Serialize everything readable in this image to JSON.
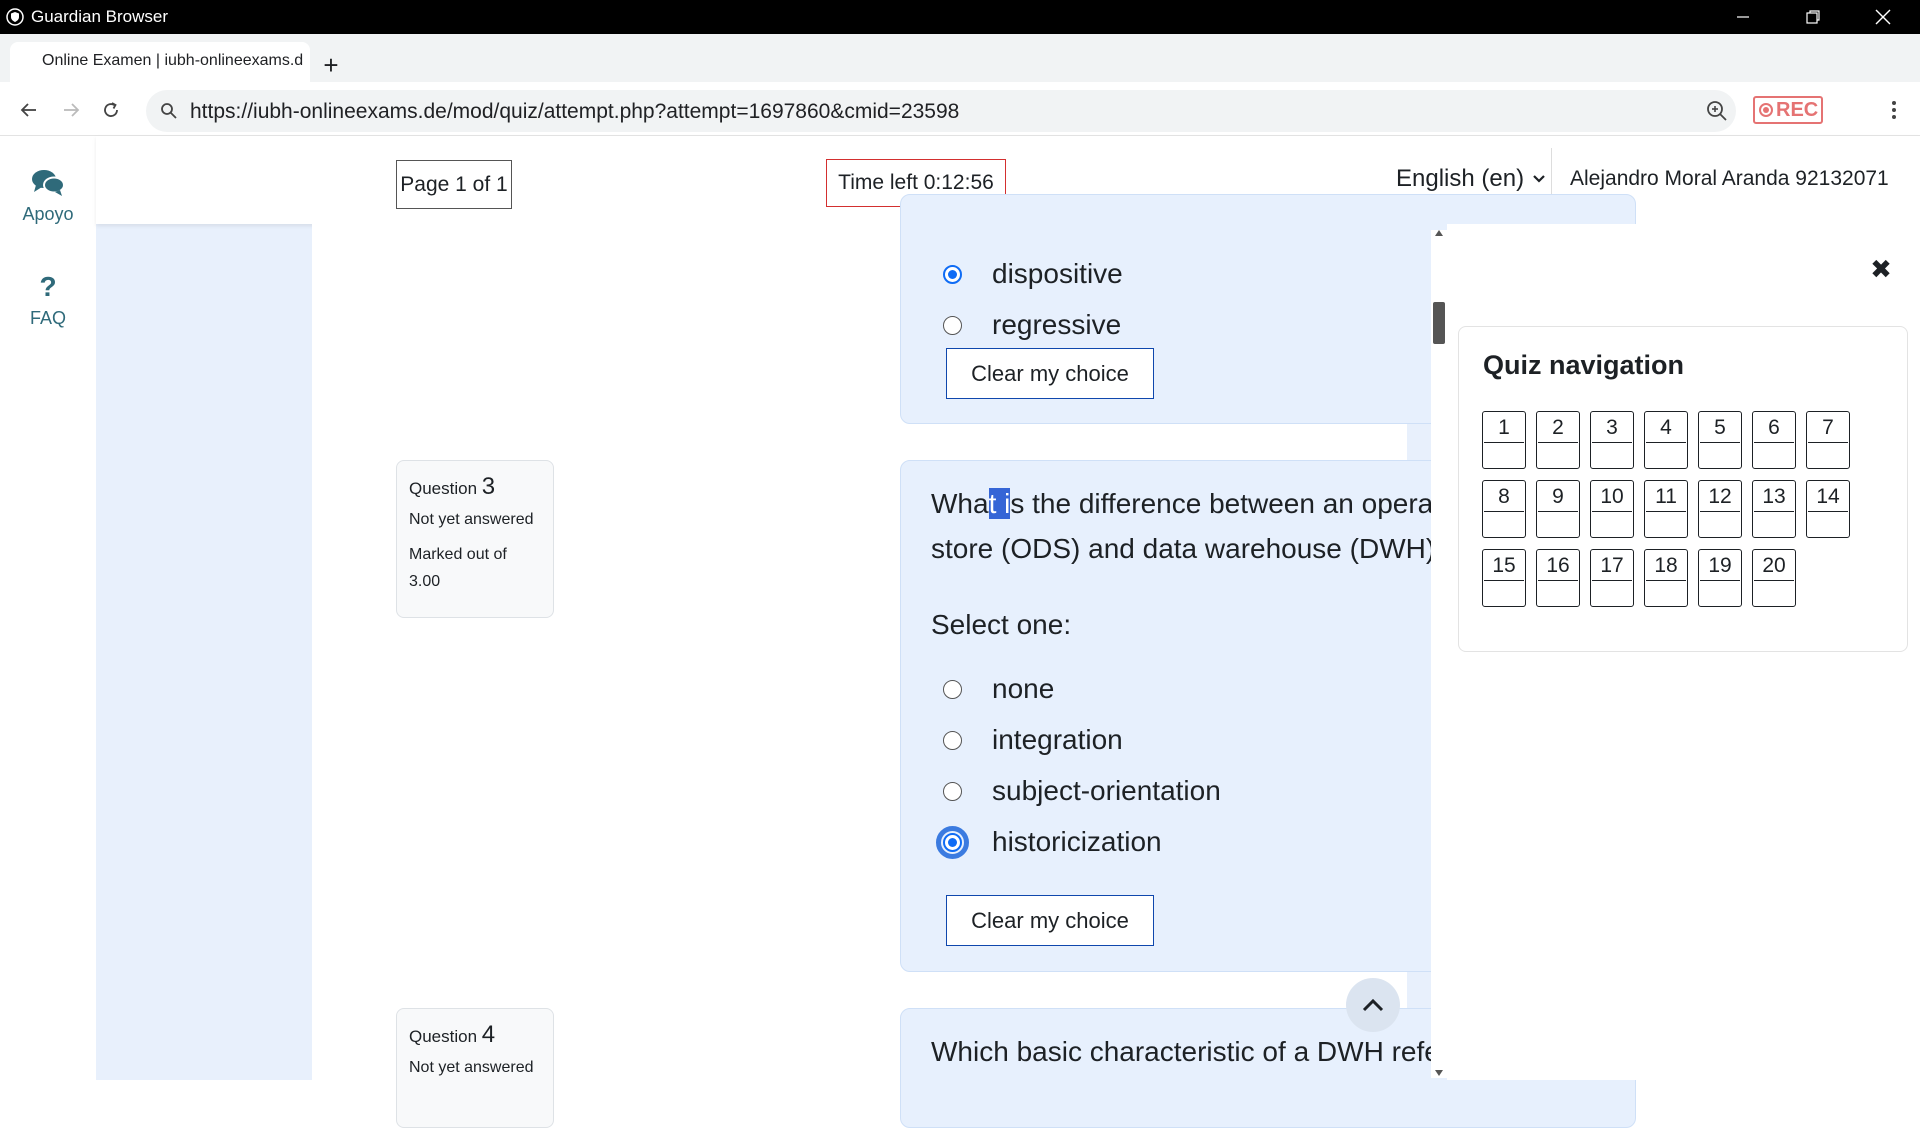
{
  "window": {
    "app_title": "Guardian Browser"
  },
  "tab": {
    "title": "Online Examen | iubh-onlineexams.d",
    "new_tab_label": "+"
  },
  "address_bar": {
    "url": "https://iubh-onlineexams.de/mod/quiz/attempt.php?attempt=1697860&cmid=23598",
    "rec_label": "REC"
  },
  "rail": {
    "support_label": "Apoyo",
    "faq_label": "FAQ",
    "faq_glyph": "?"
  },
  "header": {
    "page_indicator": "Page 1 of 1",
    "timer": "Time left 0:12:56",
    "language": "English (en)",
    "user": "Alejandro Moral Aranda 92132071"
  },
  "question2": {
    "options": [
      {
        "label": "dispositive",
        "checked": true
      },
      {
        "label": "regressive",
        "checked": false
      }
    ],
    "clear_label": "Clear my choice"
  },
  "question3": {
    "label": "Question",
    "number": "3",
    "state": "Not yet answered",
    "marked_out_of": "Marked out of",
    "mark": "3.00",
    "text_line1_a": "Wha",
    "text_line1_sel": "t i",
    "text_line1_b": "s the difference between an operational data",
    "text_line2": "store (ODS) and data warehouse (DWH)?",
    "select_one": "Select one:",
    "options": [
      {
        "label": "none",
        "checked": false
      },
      {
        "label": "integration",
        "checked": false
      },
      {
        "label": "subject-orientation",
        "checked": false
      },
      {
        "label": "historicization",
        "checked": true
      }
    ],
    "clear_label": "Clear my choice"
  },
  "question4": {
    "label": "Question",
    "number": "4",
    "state": "Not yet answered",
    "text_line1": "Which basic characteristic of a DWH refers to how"
  },
  "quiz_nav": {
    "title": "Quiz navigation",
    "close_glyph": "✖",
    "buttons": [
      "1",
      "2",
      "3",
      "4",
      "5",
      "6",
      "7",
      "8",
      "9",
      "10",
      "11",
      "12",
      "13",
      "14",
      "15",
      "16",
      "17",
      "18",
      "19",
      "20"
    ]
  },
  "colors": {
    "accent": "#0f6cf5",
    "timer_border": "#d32f2f",
    "rec": "#e57373",
    "page_bg": "#e8f0fc"
  }
}
